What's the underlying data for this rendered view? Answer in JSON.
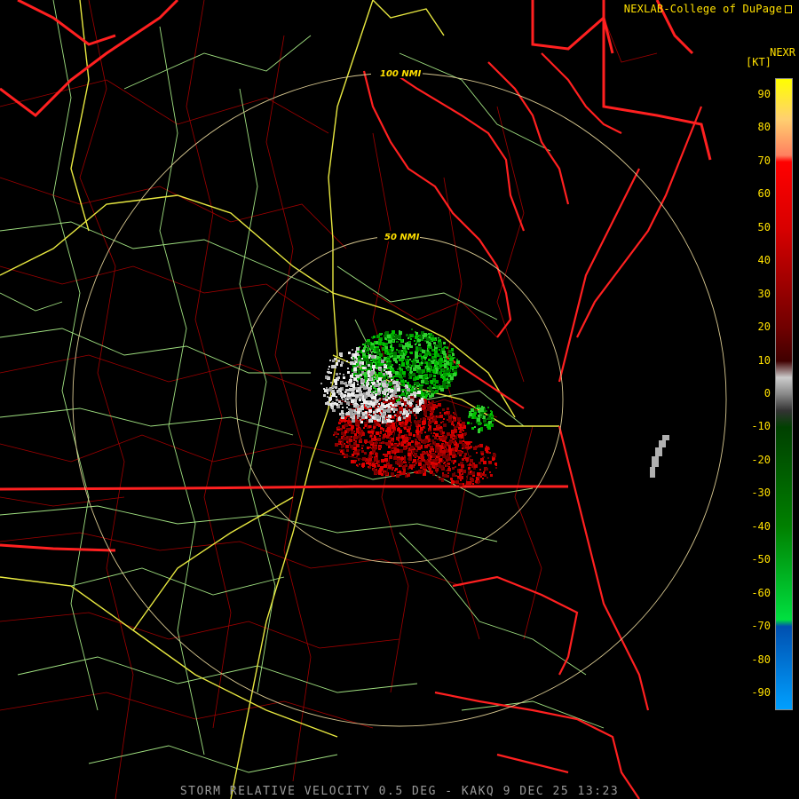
{
  "header": {
    "credit": "NEXLAB-College of DuPage",
    "credit_icon": "nexlab-logo-icon"
  },
  "legend": {
    "product": "NEXR",
    "unit": "[KT]",
    "ticks": [
      "90",
      "80",
      "70",
      "60",
      "50",
      "40",
      "30",
      "20",
      "10",
      "0",
      "-10",
      "-20",
      "-30",
      "-40",
      "-50",
      "-60",
      "-70",
      "-80",
      "-90"
    ],
    "tick_values": [
      90,
      80,
      70,
      60,
      50,
      40,
      30,
      20,
      10,
      0,
      -10,
      -20,
      -30,
      -40,
      -50,
      -60,
      -70,
      -80,
      -90
    ],
    "scale_range": [
      -95,
      95
    ],
    "color_stops": [
      {
        "value": 95,
        "color": "#ffff00"
      },
      {
        "value": 83,
        "color": "#ffd070"
      },
      {
        "value": 72,
        "color": "#ff8060"
      },
      {
        "value": 70,
        "color": "#ff0000"
      },
      {
        "value": 50,
        "color": "#d80000"
      },
      {
        "value": 20,
        "color": "#700000"
      },
      {
        "value": 10,
        "color": "#400000"
      },
      {
        "value": 5,
        "color": "#cccccc"
      },
      {
        "value": 0,
        "color": "#888888"
      },
      {
        "value": -5,
        "color": "#333333"
      },
      {
        "value": -10,
        "color": "#004000"
      },
      {
        "value": -40,
        "color": "#008000"
      },
      {
        "value": -68,
        "color": "#00e040"
      },
      {
        "value": -70,
        "color": "#0050b0"
      },
      {
        "value": -95,
        "color": "#00a0ff"
      }
    ]
  },
  "map": {
    "range_rings": [
      {
        "label": "100 NMI"
      },
      {
        "label": "50 NMI"
      }
    ],
    "colors": {
      "state_border": "#ff2020",
      "county_border": "#a00000",
      "coastline": "#ff2020",
      "highway_major": "#e8e840",
      "highway_minor": "#a0e080",
      "range_ring": "#d8c890",
      "inbound": "#00c000",
      "outbound": "#c00000"
    }
  },
  "footer": {
    "caption": "STORM RELATIVE VELOCITY 0.5 DEG - KAKQ 9 DEC 25 13:23"
  }
}
